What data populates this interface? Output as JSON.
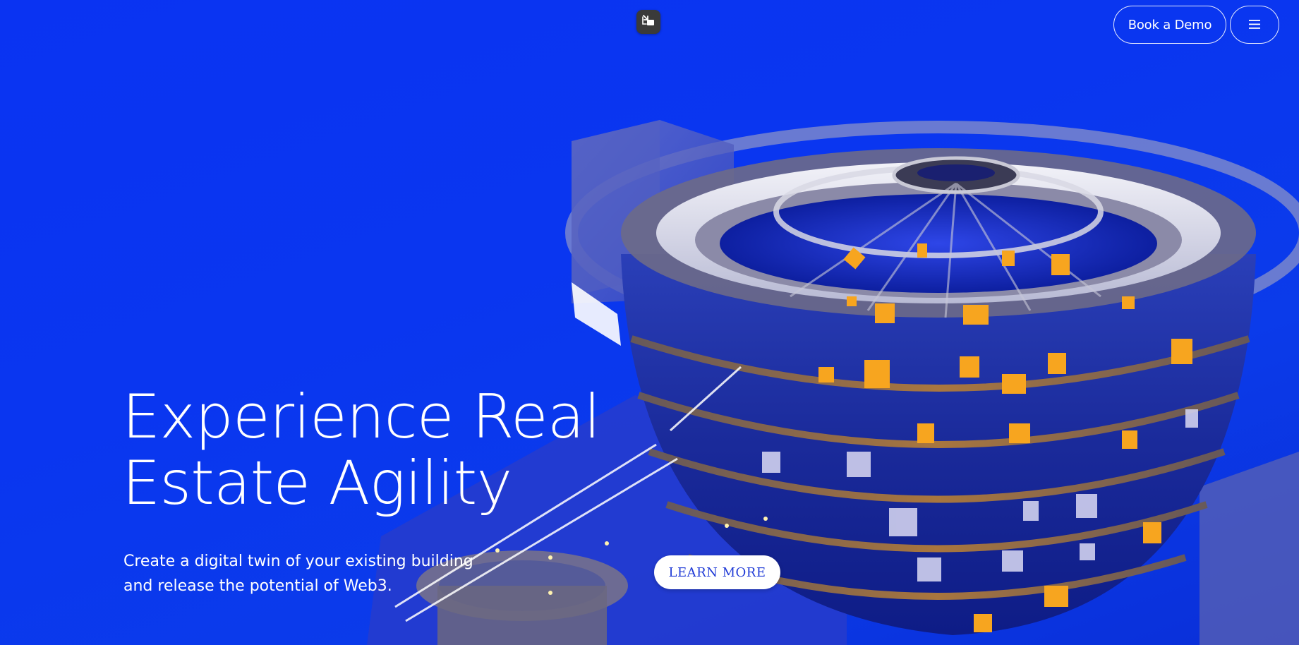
{
  "header": {
    "book_demo_label": "Book a Demo",
    "menu_icon": "hamburger-icon",
    "pip_icon": "exit-picture-in-picture-icon"
  },
  "hero": {
    "headline_line1": "Experience Real",
    "headline_line2": "Estate Agility",
    "subtext_line1": "Create a digital twin of your existing building",
    "subtext_line2": "and release the potential of Web3.",
    "cta_label": "LEARN MORE"
  },
  "colors": {
    "background": "#0a33f2",
    "cta_text": "#1f3ad6",
    "window_light": "#f5a623",
    "text": "#ffffff"
  }
}
